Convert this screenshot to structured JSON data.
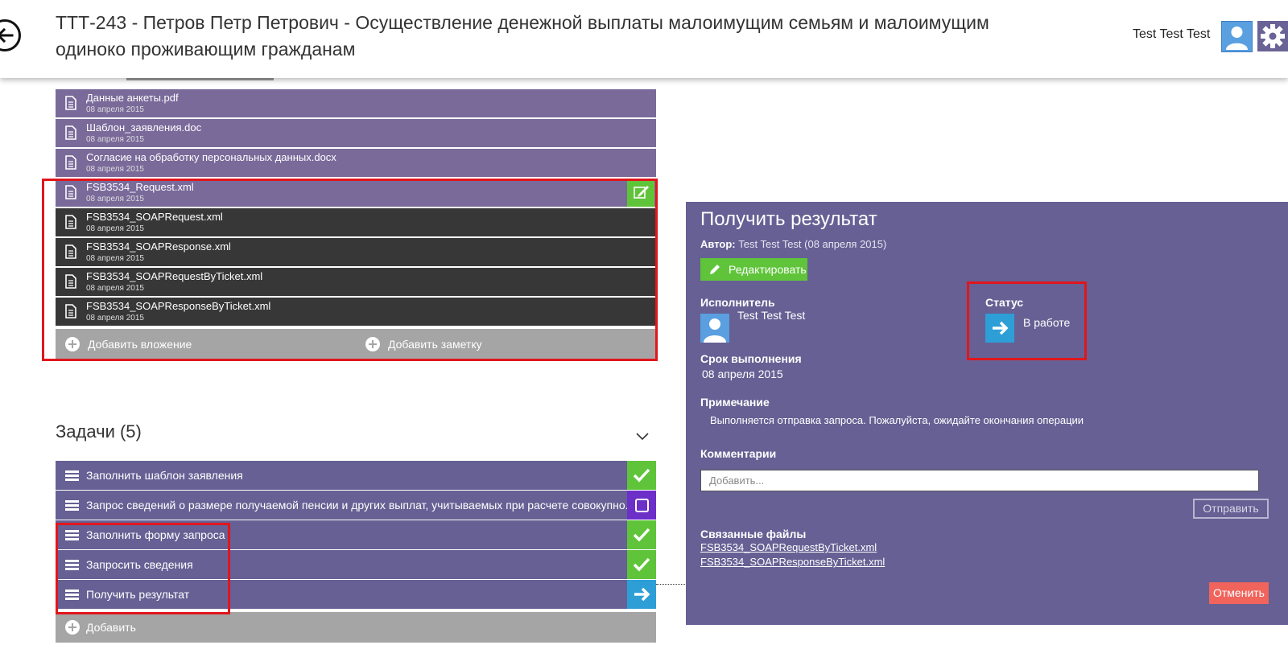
{
  "header": {
    "title": "ТТТ-243 -  Петров Петр  Петрович - Осуществление денежной выплаты малоимущим семьям и малоимущим одиноко проживающим гражданам",
    "user_name": "Test Test Test",
    "back_icon": "arrow-left-icon",
    "settings_icon": "gear-icon",
    "avatar_icon": "user-avatar-icon"
  },
  "attachments": {
    "items": [
      {
        "name": "Данные анкеты.pdf",
        "date": "08 апреля 2015"
      },
      {
        "name": "Шаблон_заявления.doc",
        "date": "08 апреля 2015"
      },
      {
        "name": "Согласие на обработку персональных данных.docx",
        "date": "08 апреля 2015"
      },
      {
        "name": "FSB3534_Request.xml",
        "date": "08 апреля 2015"
      },
      {
        "name": "FSB3534_SOAPRequest.xml",
        "date": "08 апреля 2015"
      },
      {
        "name": "FSB3534_SOAPResponse.xml",
        "date": "08 апреля 2015"
      },
      {
        "name": "FSB3534_SOAPRequestByTicket.xml",
        "date": "08 апреля 2015"
      },
      {
        "name": "FSB3534_SOAPResponseByTicket.xml",
        "date": "08 апреля 2015"
      }
    ],
    "add_attachment": "Добавить вложение",
    "add_note": "Добавить заметку"
  },
  "tasks": {
    "title": "Задачи (5)",
    "items": [
      {
        "label": "Заполнить шаблон заявления",
        "status": "done"
      },
      {
        "label": "Запрос сведений о размере получаемой пенсии и других выплат, учитываемых при расчете совокупно...",
        "status": "todo"
      },
      {
        "label": "Заполнить форму запроса",
        "status": "done"
      },
      {
        "label": "Запросить сведения",
        "status": "done"
      },
      {
        "label": "Получить результат",
        "status": "active"
      }
    ],
    "add_label": "Добавить"
  },
  "detail": {
    "title": "Получить результат",
    "author_label": "Автор:",
    "author_value": "Test Test Test (08 апреля 2015)",
    "edit_label": "Редактировать",
    "executor_label": "Исполнитель",
    "executor_name": "Test Test Test",
    "status_label": "Статус",
    "status_value": "В работе",
    "deadline_label": "Срок выполнения",
    "deadline_value": "08 апреля 2015",
    "note_label": "Примечание",
    "note_value": "Выполняется отправка запроса. Пожалуйста, ожидайте окончания операции",
    "comments_label": "Комментарии",
    "comment_placeholder": "Добавить...",
    "send_label": "Отправить",
    "linked_files_label": "Связанные файлы",
    "linked_files": [
      "FSB3534_SOAPRequestByTicket.xml",
      "FSB3534_SOAPResponseByTicket.xml"
    ],
    "cancel_label": "Отменить"
  },
  "colors": {
    "purple_row": "#7a6a9a",
    "dark_row": "#373737",
    "task_row": "#666094",
    "done": "#5fc43a",
    "todo": "#6c2fc8",
    "active": "#2e9ed6",
    "cancel": "#f0645c",
    "annotation": "#e0161c"
  }
}
